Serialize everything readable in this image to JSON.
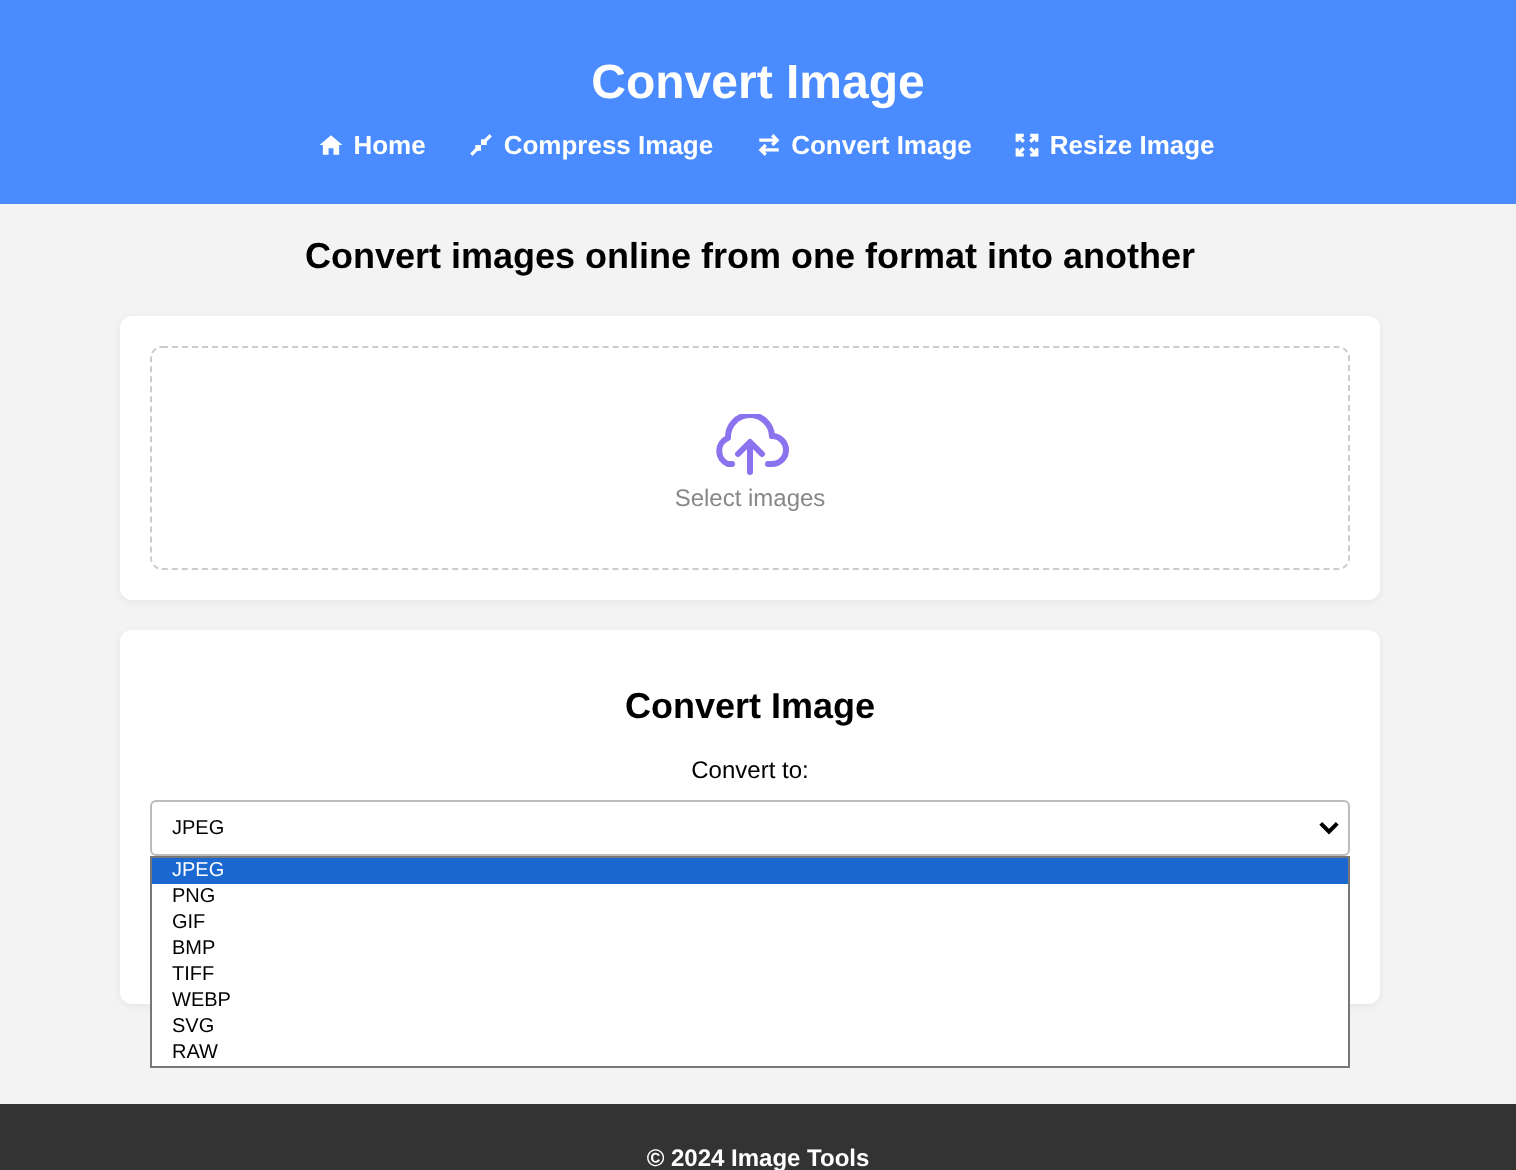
{
  "header": {
    "title": "Convert Image",
    "nav": [
      {
        "kind": "home",
        "label": "Home"
      },
      {
        "kind": "compress",
        "label": "Compress Image"
      },
      {
        "kind": "convert",
        "label": "Convert Image"
      },
      {
        "kind": "resize",
        "label": "Resize Image"
      }
    ]
  },
  "subtitle": "Convert images online from one format into another",
  "upload": {
    "label": "Select images"
  },
  "converter": {
    "title": "Convert Image",
    "field_label": "Convert to:",
    "value": "JPEG",
    "expanded": true,
    "options": [
      {
        "label": "JPEG",
        "selected": true
      },
      {
        "label": "PNG",
        "selected": false
      },
      {
        "label": "GIF",
        "selected": false
      },
      {
        "label": "BMP",
        "selected": false
      },
      {
        "label": "TIFF",
        "selected": false
      },
      {
        "label": "WEBP",
        "selected": false
      },
      {
        "label": "SVG",
        "selected": false
      },
      {
        "label": "RAW",
        "selected": false
      }
    ]
  },
  "footer": "© 2024 Image Tools"
}
